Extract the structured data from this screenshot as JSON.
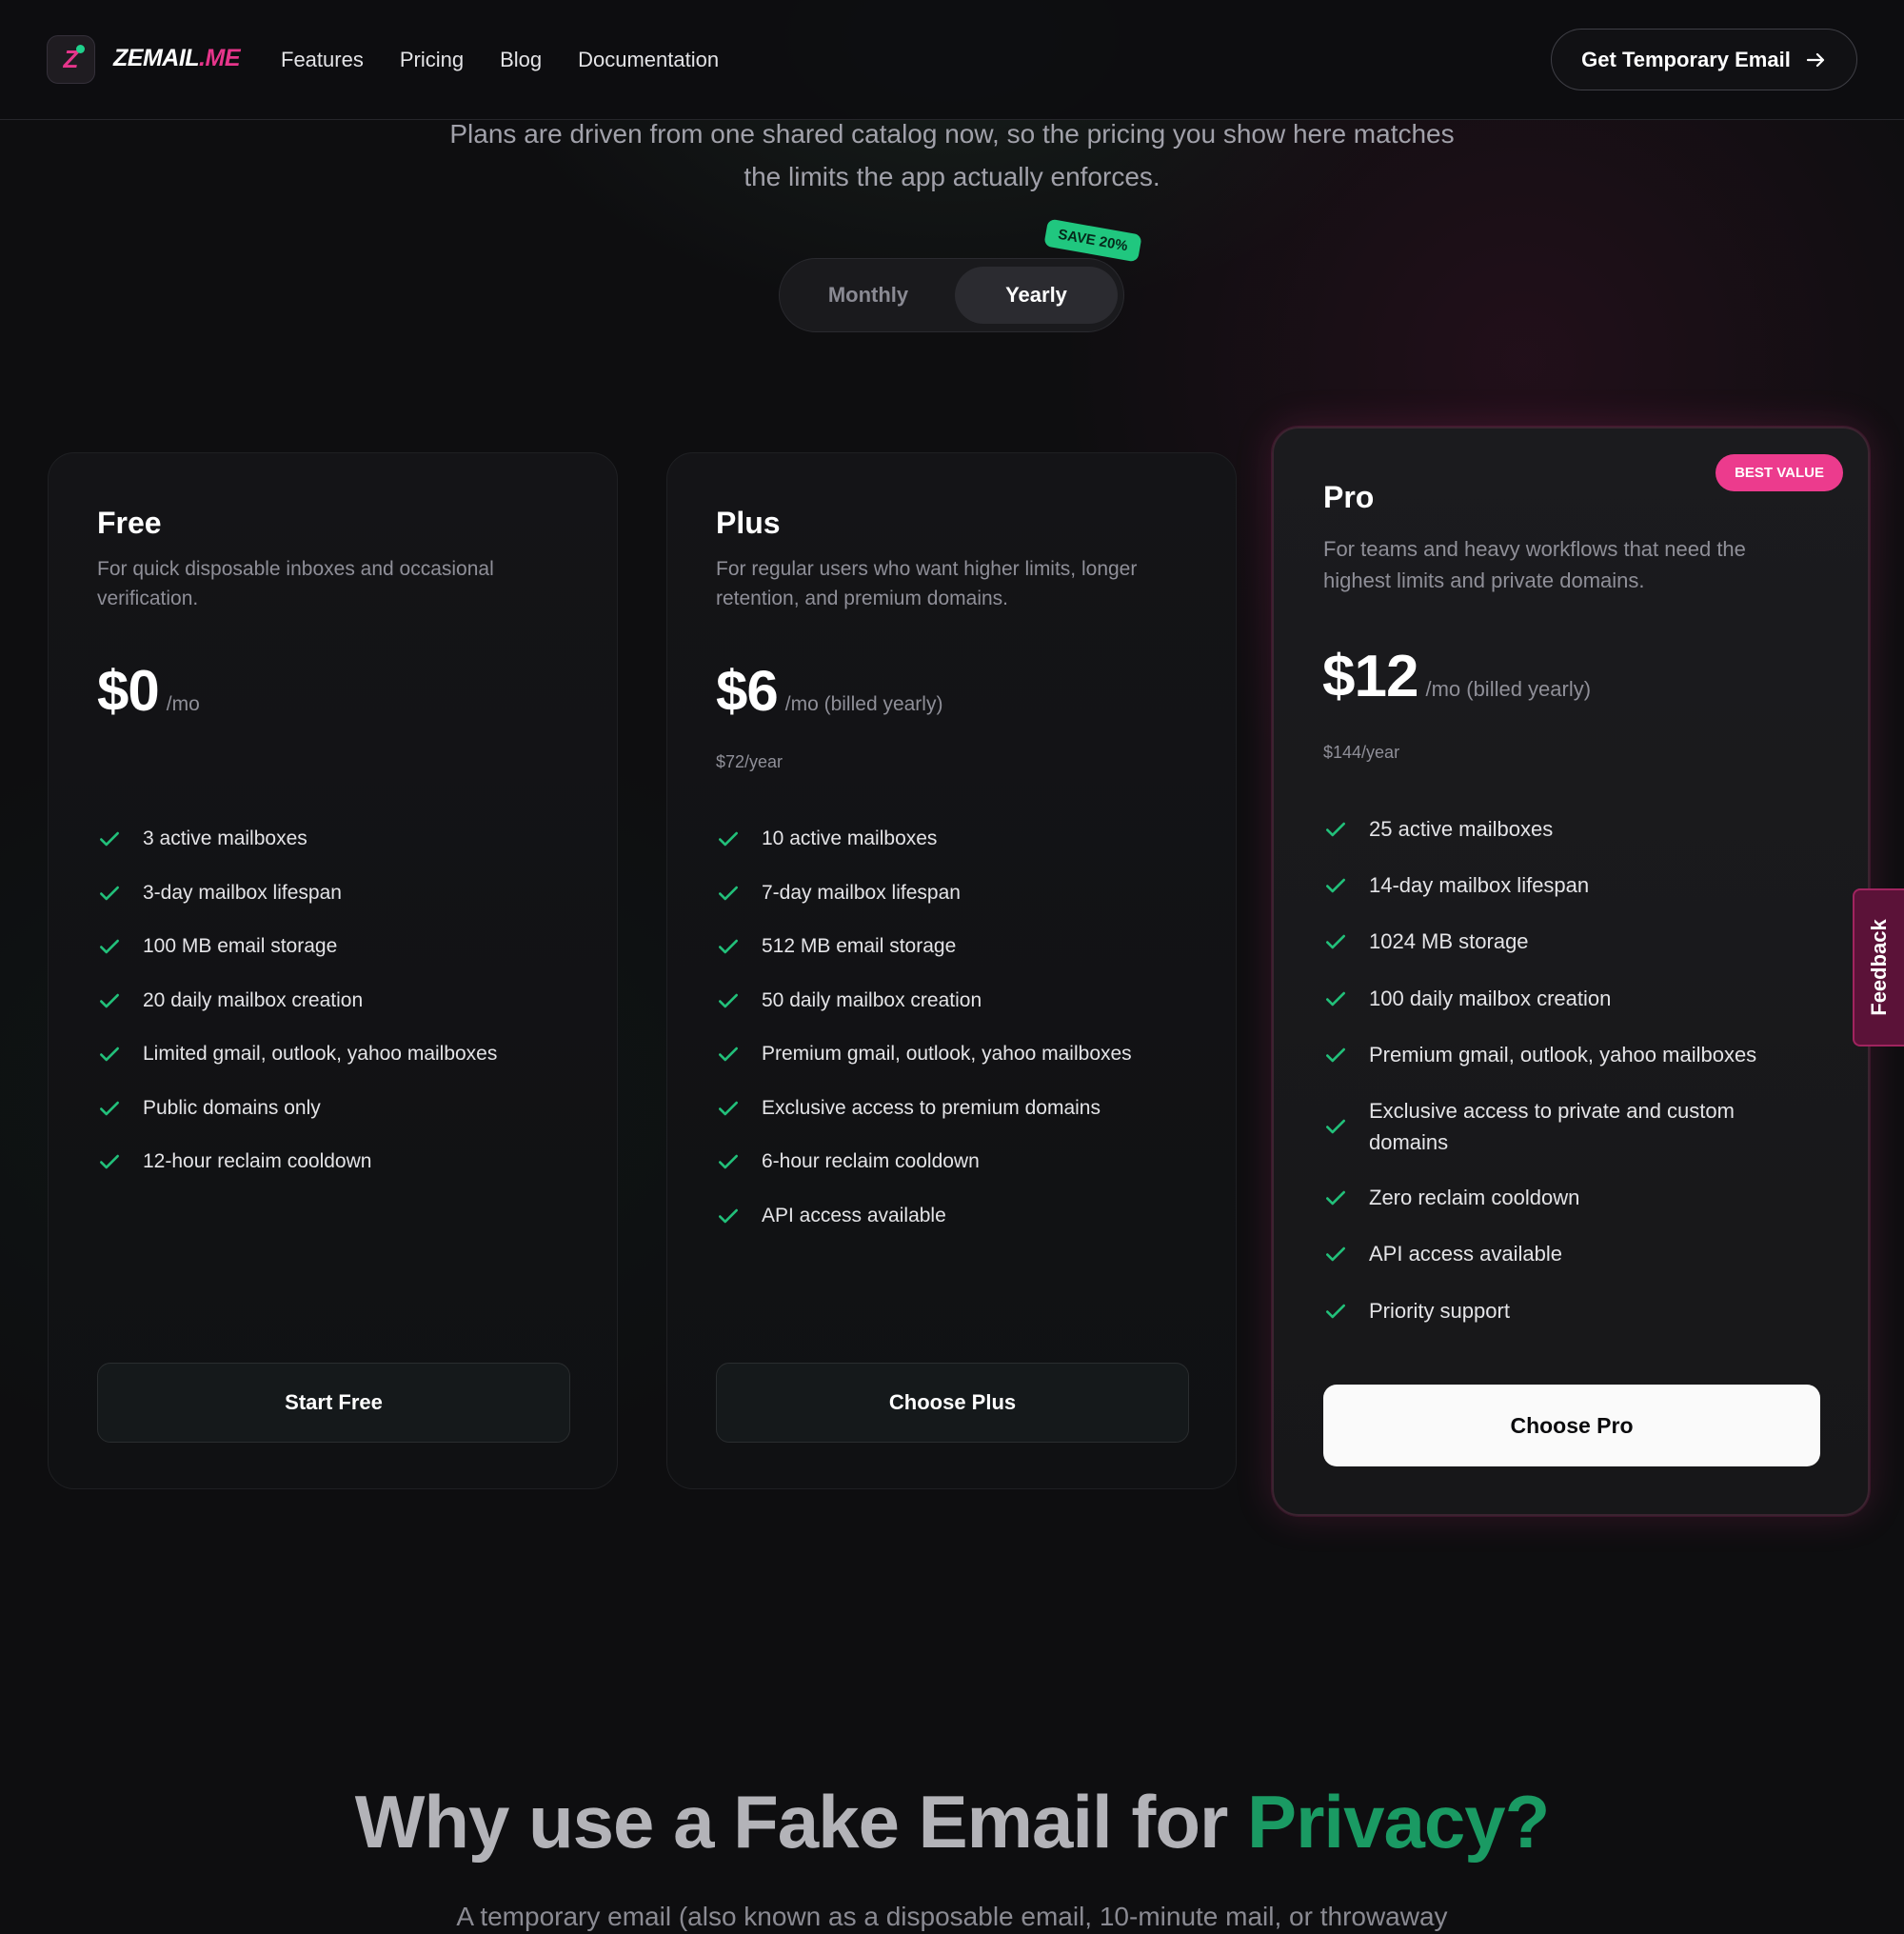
{
  "brand": {
    "name_part1": "ZEMAIL",
    "name_part2": ".ME"
  },
  "nav": {
    "links": [
      "Features",
      "Pricing",
      "Blog",
      "Documentation"
    ],
    "cta_label": "Get Temporary Email"
  },
  "hero": {
    "subtitle": "Plans are driven from one shared catalog now, so the pricing you show here matches the limits the app actually enforces."
  },
  "billing_toggle": {
    "monthly_label": "Monthly",
    "yearly_label": "Yearly",
    "selected": "Yearly",
    "save_badge": "SAVE 20%"
  },
  "plans": [
    {
      "name": "Free",
      "description": "For quick disposable inboxes and occasional verification.",
      "price": "$0",
      "period": "/mo",
      "yearly_note": "",
      "features": [
        "3 active mailboxes",
        "3-day mailbox lifespan",
        "100 MB email storage",
        "20 daily mailbox creation",
        "Limited gmail, outlook, yahoo mailboxes",
        "Public domains only",
        "12-hour reclaim cooldown"
      ],
      "button": "Start Free"
    },
    {
      "name": "Plus",
      "description": "For regular users who want higher limits, longer retention, and premium domains.",
      "price": "$6",
      "period": "/mo (billed yearly)",
      "yearly_note": "$72/year",
      "features": [
        "10 active mailboxes",
        "7-day mailbox lifespan",
        "512 MB email storage",
        "50 daily mailbox creation",
        "Premium gmail, outlook, yahoo mailboxes",
        "Exclusive access to premium domains",
        "6-hour reclaim cooldown",
        "API access available"
      ],
      "button": "Choose Plus"
    },
    {
      "name": "Pro",
      "badge": "BEST VALUE",
      "description": "For teams and heavy workflows that need the highest limits and private domains.",
      "price": "$12",
      "period": "/mo (billed yearly)",
      "yearly_note": "$144/year",
      "features": [
        "25 active mailboxes",
        "14-day mailbox lifespan",
        "1024 MB storage",
        "100 daily mailbox creation",
        "Premium gmail, outlook, yahoo mailboxes",
        "Exclusive access to private and custom domains",
        "Zero reclaim cooldown",
        "API access available",
        "Priority support"
      ],
      "button": "Choose Pro"
    }
  ],
  "feedback_tab": "Feedback",
  "why": {
    "title_main": "Why use a Fake Email for ",
    "title_highlight": "Privacy?",
    "subtitle": "A temporary email (also known as a disposable email, 10-minute mail, or throwaway"
  },
  "colors": {
    "accent_pink": "#e6358b",
    "accent_green": "#20c77f",
    "check_green": "#22c07a",
    "highlight_green": "#1a9a63"
  },
  "icons": {
    "cta_arrow": "arrow-right-icon",
    "feature_check": "check-icon"
  }
}
